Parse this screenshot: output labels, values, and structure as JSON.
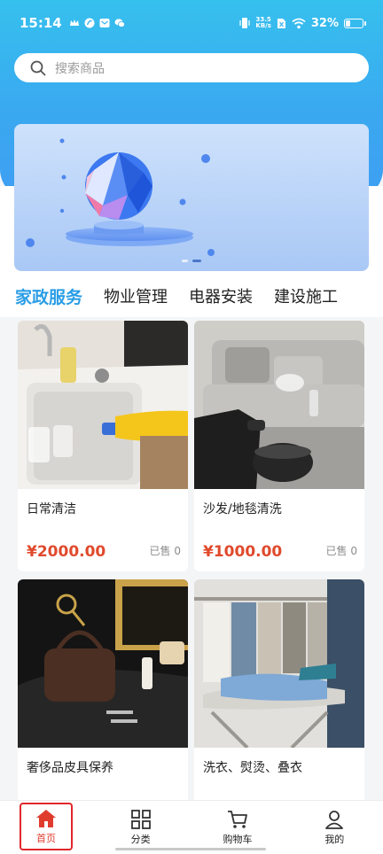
{
  "status_bar": {
    "time": "15:14",
    "network_speed_value": "33.5",
    "network_speed_unit": "KB/s",
    "battery": "32%",
    "battery_level": 0.32
  },
  "search": {
    "placeholder": "搜索商品",
    "icon": "search-icon"
  },
  "banner": {
    "slides": 2,
    "active_slide": 2
  },
  "tabs": [
    {
      "label": "家政服务",
      "active": true
    },
    {
      "label": "物业管理",
      "active": false
    },
    {
      "label": "电器安装",
      "active": false
    },
    {
      "label": "建设施工",
      "active": false
    }
  ],
  "products": [
    {
      "title": "日常清洁",
      "price": "¥2000.00",
      "sold": "已售 0"
    },
    {
      "title": "沙发/地毯清洗",
      "price": "¥1000.00",
      "sold": "已售 0"
    },
    {
      "title": "奢侈品皮具保养"
    },
    {
      "title": "洗衣、熨烫、叠衣"
    }
  ],
  "bottom_nav": [
    {
      "label": "首页",
      "icon": "home-icon",
      "active": true
    },
    {
      "label": "分类",
      "icon": "grid-icon",
      "active": false
    },
    {
      "label": "购物车",
      "icon": "cart-icon",
      "active": false
    },
    {
      "label": "我的",
      "icon": "user-icon",
      "active": false
    }
  ],
  "colors": {
    "accent": "#2a9de6",
    "price": "#e04a2c",
    "nav_active": "#e03c2e",
    "header": "#38b4ef"
  }
}
